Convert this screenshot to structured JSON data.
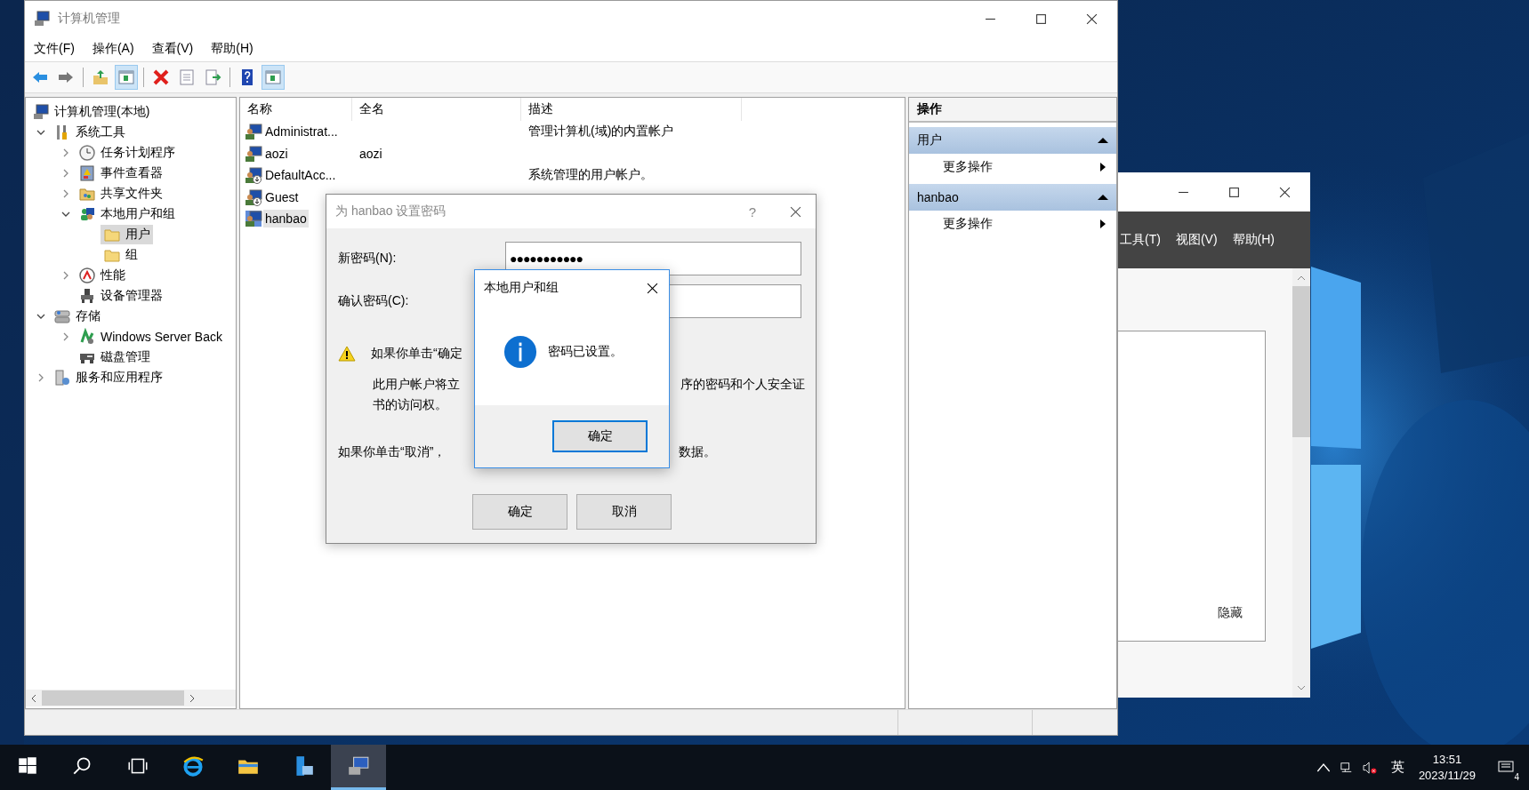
{
  "main_window": {
    "title": "计算机管理",
    "menu": [
      "文件(F)",
      "操作(A)",
      "查看(V)",
      "帮助(H)"
    ],
    "toolbar": [
      {
        "kind": "back",
        "selected": false
      },
      {
        "kind": "forward",
        "selected": false
      },
      {
        "kind": "separator"
      },
      {
        "kind": "up",
        "selected": false
      },
      {
        "kind": "console-tree",
        "selected": true
      },
      {
        "kind": "separator"
      },
      {
        "kind": "delete",
        "selected": false
      },
      {
        "kind": "properties",
        "selected": false
      },
      {
        "kind": "export",
        "selected": false
      },
      {
        "kind": "separator"
      },
      {
        "kind": "help",
        "selected": false
      },
      {
        "kind": "action-pane",
        "selected": true
      }
    ],
    "tree": [
      {
        "label": "计算机管理(本地)",
        "kind": "computer",
        "selected": false,
        "children": [
          {
            "label": "系统工具",
            "kind": "tools",
            "selected": false,
            "expanded": true,
            "children": [
              {
                "label": "任务计划程序",
                "kind": "clock",
                "selected": false,
                "expanded": false
              },
              {
                "label": "事件查看器",
                "kind": "log",
                "selected": false,
                "expanded": false
              },
              {
                "label": "共享文件夹",
                "kind": "share",
                "selected": false,
                "expanded": false
              },
              {
                "label": "本地用户和组",
                "kind": "users",
                "selected": false,
                "expanded": true,
                "children": [
                  {
                    "label": "用户",
                    "kind": "folder",
                    "selected": true
                  },
                  {
                    "label": "组",
                    "kind": "folder",
                    "selected": false
                  }
                ]
              },
              {
                "label": "性能",
                "kind": "gauge",
                "selected": false,
                "expanded": false
              },
              {
                "label": "设备管理器",
                "kind": "device",
                "selected": false
              }
            ]
          },
          {
            "label": "存储",
            "kind": "storage",
            "selected": false,
            "expanded": true,
            "children": [
              {
                "label": "Windows Server Back",
                "kind": "backup",
                "selected": false,
                "expanded": false
              },
              {
                "label": "磁盘管理",
                "kind": "disk",
                "selected": false
              }
            ]
          },
          {
            "label": "服务和应用程序",
            "kind": "services",
            "selected": false,
            "expanded": false
          }
        ]
      }
    ],
    "columns": [
      "名称",
      "全名",
      "描述"
    ],
    "rows": [
      {
        "name": "Administrat...",
        "description": "管理计算机(域)的内置帐户",
        "disabled": false,
        "selected": false
      },
      {
        "name": "aozi",
        "full_name": "aozi",
        "disabled": false,
        "selected": false
      },
      {
        "name": "DefaultAcc...",
        "description": "系统管理的用户帐户。",
        "disabled": true,
        "selected": false
      },
      {
        "name": "Guest",
        "disabled": true,
        "selected": false
      },
      {
        "name": "hanbao",
        "disabled": false,
        "selected": true
      }
    ],
    "actions": {
      "title": "操作",
      "sections": [
        {
          "title": "用户",
          "expanded": true,
          "items": [
            "更多操作"
          ]
        },
        {
          "title": "hanbao",
          "expanded": true,
          "items": [
            "更多操作"
          ]
        }
      ]
    }
  },
  "password_dialog": {
    "title": "为 hanbao 设置密码",
    "help": "?",
    "fields": [
      {
        "label": "新密码(N):",
        "value": "●●●●●●●●●●●"
      },
      {
        "label": "确认密码(C):"
      }
    ],
    "warning": "如果你单击“确定",
    "body_lines": [
      [
        "此用户帐户将立",
        "序的密码和个人安全证"
      ],
      [
        "书的访问权。"
      ]
    ],
    "cancel_note": [
      "如果你单击“取消”，",
      "数据。"
    ],
    "buttons": [
      "确定",
      "取消"
    ]
  },
  "message_box": {
    "title": "本地用户和组",
    "message": "密码已设置。",
    "button": "确定"
  },
  "background_window": {
    "menu": [
      "工具(T)",
      "视图(V)",
      "帮助(H)"
    ],
    "panel_text": "隐藏"
  },
  "taskbar": {
    "apps": [
      {
        "kind": "start",
        "active": false
      },
      {
        "kind": "search",
        "active": false
      },
      {
        "kind": "task-view",
        "active": false
      },
      {
        "kind": "browser",
        "active": false
      },
      {
        "kind": "explorer",
        "active": false
      },
      {
        "kind": "server",
        "active": false
      },
      {
        "kind": "computer",
        "active": true
      }
    ],
    "input_method": "英",
    "time": "13:51",
    "date": "2023/11/29",
    "notifications": "4"
  }
}
